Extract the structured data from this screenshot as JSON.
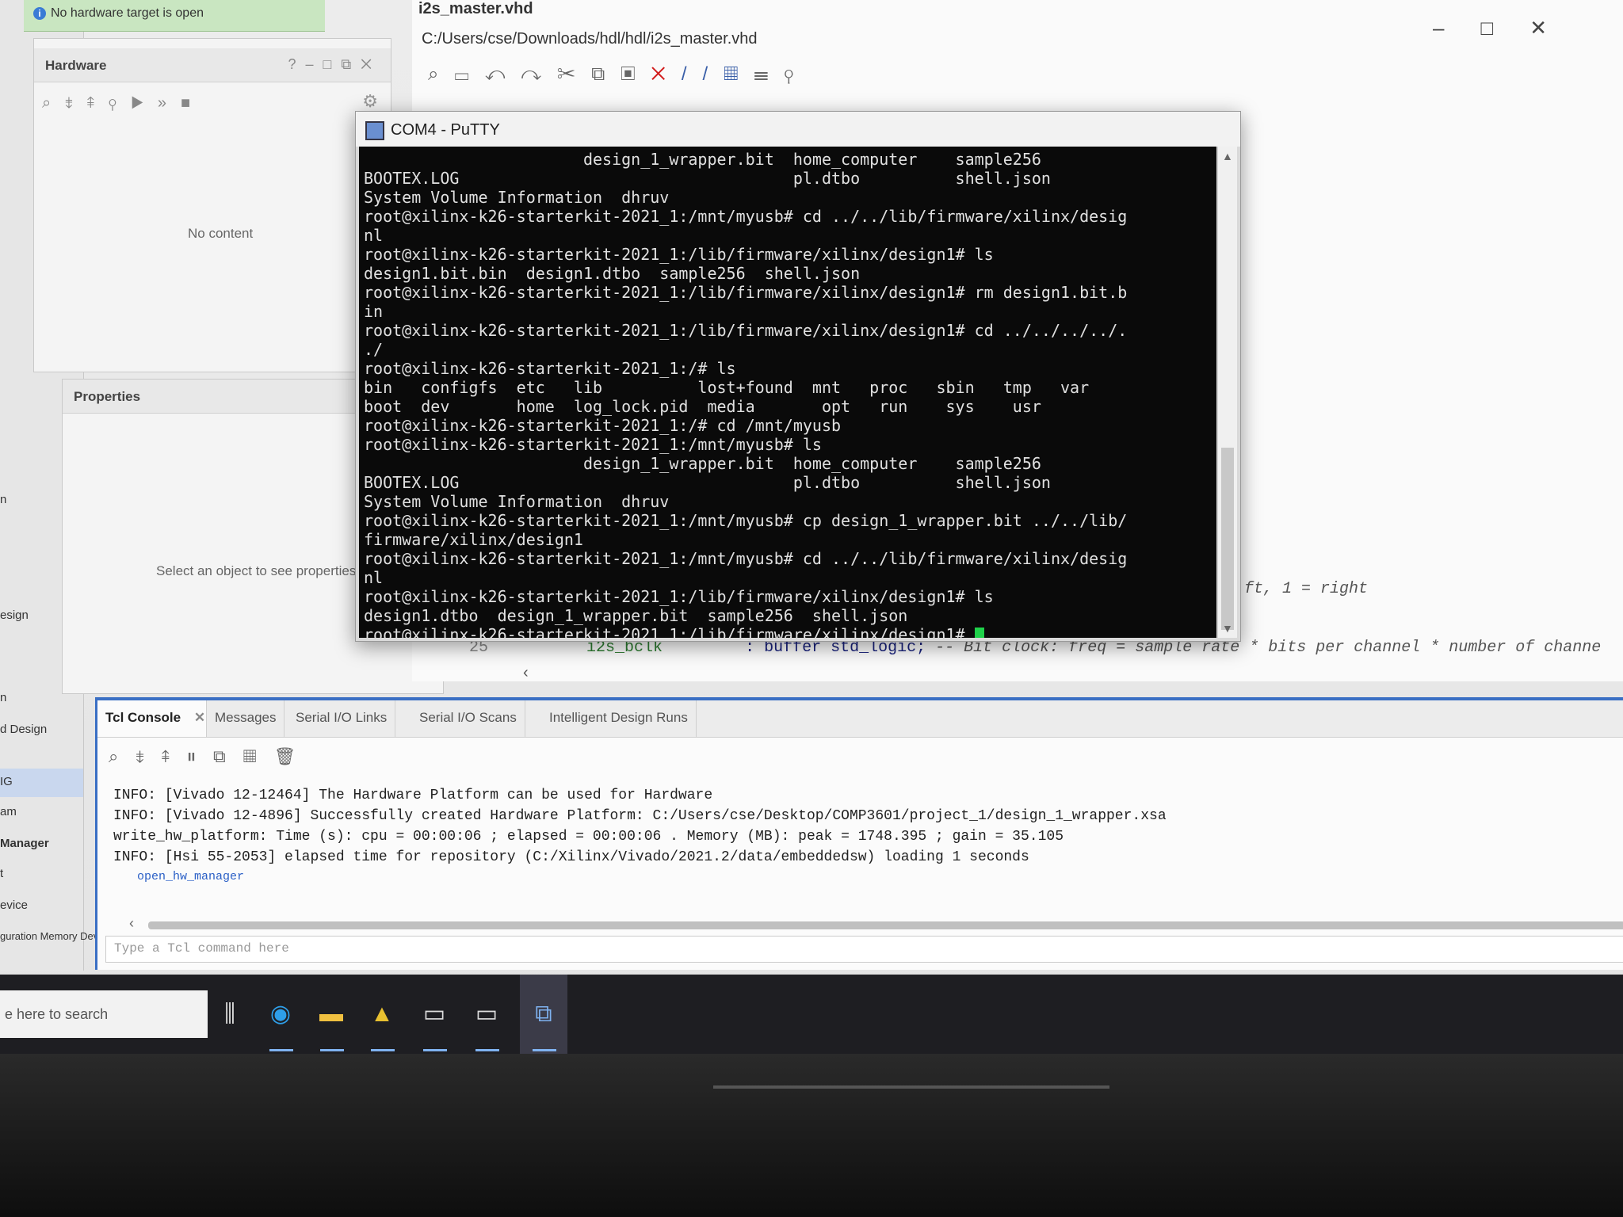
{
  "banner": {
    "text": "No hardware target is open"
  },
  "hardware_panel": {
    "title": "Hardware",
    "empty": "No content"
  },
  "properties_panel": {
    "title": "Properties",
    "empty": "Select an object to see properties"
  },
  "left_nav": {
    "items": [
      "n",
      "esign",
      "n",
      "d Design",
      "IG",
      "am",
      "Manager",
      "t",
      "evice",
      "guration Memory Devi"
    ]
  },
  "editor": {
    "title": "i2s_master.vhd",
    "path": "C:/Users/cse/Downloads/hdl/hdl/i2s_master.vhd",
    "visible_comment": "ft, 1 = right",
    "line_number": "25",
    "line_signal": "i2s_bclk",
    "line_type": ": buffer std_logic;",
    "line_comment": "-- Bit clock: freq = sample rate * bits per channel * number of channe"
  },
  "putty": {
    "title": "COM4 - PuTTY",
    "lines": [
      "                       design_1_wrapper.bit  home_computer    sample256",
      "BOOTEX.LOG                                   pl.dtbo          shell.json",
      "System Volume Information  dhruv",
      "root@xilinx-k26-starterkit-2021_1:/mnt/myusb# cd ../../lib/firmware/xilinx/desig",
      "nl",
      "root@xilinx-k26-starterkit-2021_1:/lib/firmware/xilinx/design1# ls",
      "design1.bit.bin  design1.dtbo  sample256  shell.json",
      "root@xilinx-k26-starterkit-2021_1:/lib/firmware/xilinx/design1# rm design1.bit.b",
      "in",
      "root@xilinx-k26-starterkit-2021_1:/lib/firmware/xilinx/design1# cd ../../../../.",
      "./",
      "root@xilinx-k26-starterkit-2021_1:/# ls",
      "bin   configfs  etc   lib          lost+found  mnt   proc   sbin   tmp   var",
      "boot  dev       home  log_lock.pid  media       opt   run    sys    usr",
      "root@xilinx-k26-starterkit-2021_1:/# cd /mnt/myusb",
      "root@xilinx-k26-starterkit-2021_1:/mnt/myusb# ls",
      "                       design_1_wrapper.bit  home_computer    sample256",
      "BOOTEX.LOG                                   pl.dtbo          shell.json",
      "System Volume Information  dhruv",
      "root@xilinx-k26-starterkit-2021_1:/mnt/myusb# cp design_1_wrapper.bit ../../lib/",
      "firmware/xilinx/design1",
      "root@xilinx-k26-starterkit-2021_1:/mnt/myusb# cd ../../lib/firmware/xilinx/desig",
      "nl",
      "root@xilinx-k26-starterkit-2021_1:/lib/firmware/xilinx/design1# ls",
      "design1.dtbo  design_1_wrapper.bit  sample256  shell.json",
      "root@xilinx-k26-starterkit-2021_1:/lib/firmware/xilinx/design1# "
    ]
  },
  "console": {
    "tabs": [
      "Tcl Console",
      "Messages",
      "Serial I/O Links",
      "Serial I/O Scans",
      "Intelligent Design Runs"
    ],
    "log": [
      "INFO: [Vivado 12-12464] The Hardware Platform can be used for Hardware",
      "INFO: [Vivado 12-4896] Successfully created Hardware Platform: C:/Users/cse/Desktop/COMP3601/project_1/design_1_wrapper.xsa",
      "write_hw_platform: Time (s): cpu = 00:00:06 ; elapsed = 00:00:06 . Memory (MB): peak = 1748.395 ; gain = 35.105",
      "INFO: [Hsi 55-2053] elapsed time for repository (C:/Xilinx/Vivado/2021.2/data/embeddedsw) loading 1 seconds"
    ],
    "link": "open_hw_manager",
    "input_placeholder": "Type a Tcl command here"
  },
  "taskbar": {
    "search": "e here to search",
    "icons": [
      "task-view-icon",
      "edge-icon",
      "file-explorer-icon",
      "vivado-icon",
      "terminal-icon",
      "terminal-icon-2",
      "putty-icon"
    ]
  }
}
